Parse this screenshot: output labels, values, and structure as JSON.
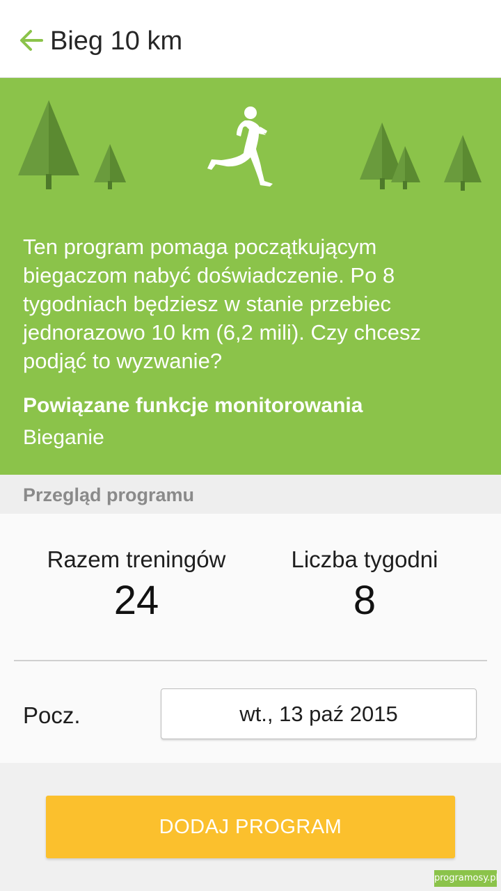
{
  "header": {
    "title": "Bieg 10 km",
    "back_icon": "arrow-left-icon",
    "accent_color": "#8bc34a"
  },
  "hero": {
    "background_color": "#8bc34a",
    "illustration": "runner-with-trees",
    "description": "Ten program pomaga początkującym biegaczom nabyć doświadczenie. Po 8 tygodniach będziesz w stanie przebiec jednorazowo 10 km (6,2 mili). Czy chcesz podjąć to wyzwanie?",
    "related_title": "Powiązane funkcje monitorowania",
    "related_value": "Bieganie"
  },
  "overview": {
    "section_title": "Przegląd programu",
    "total_workouts_label": "Razem treningów",
    "total_workouts_value": "24",
    "weeks_label": "Liczba tygodni",
    "weeks_value": "8",
    "start_label": "Pocz.",
    "start_date": "wt., 13 paź 2015"
  },
  "actions": {
    "add_program_label": "DODAJ PROGRAM",
    "button_color": "#fbc02d"
  },
  "watermark": {
    "text": "programosy.pl"
  }
}
